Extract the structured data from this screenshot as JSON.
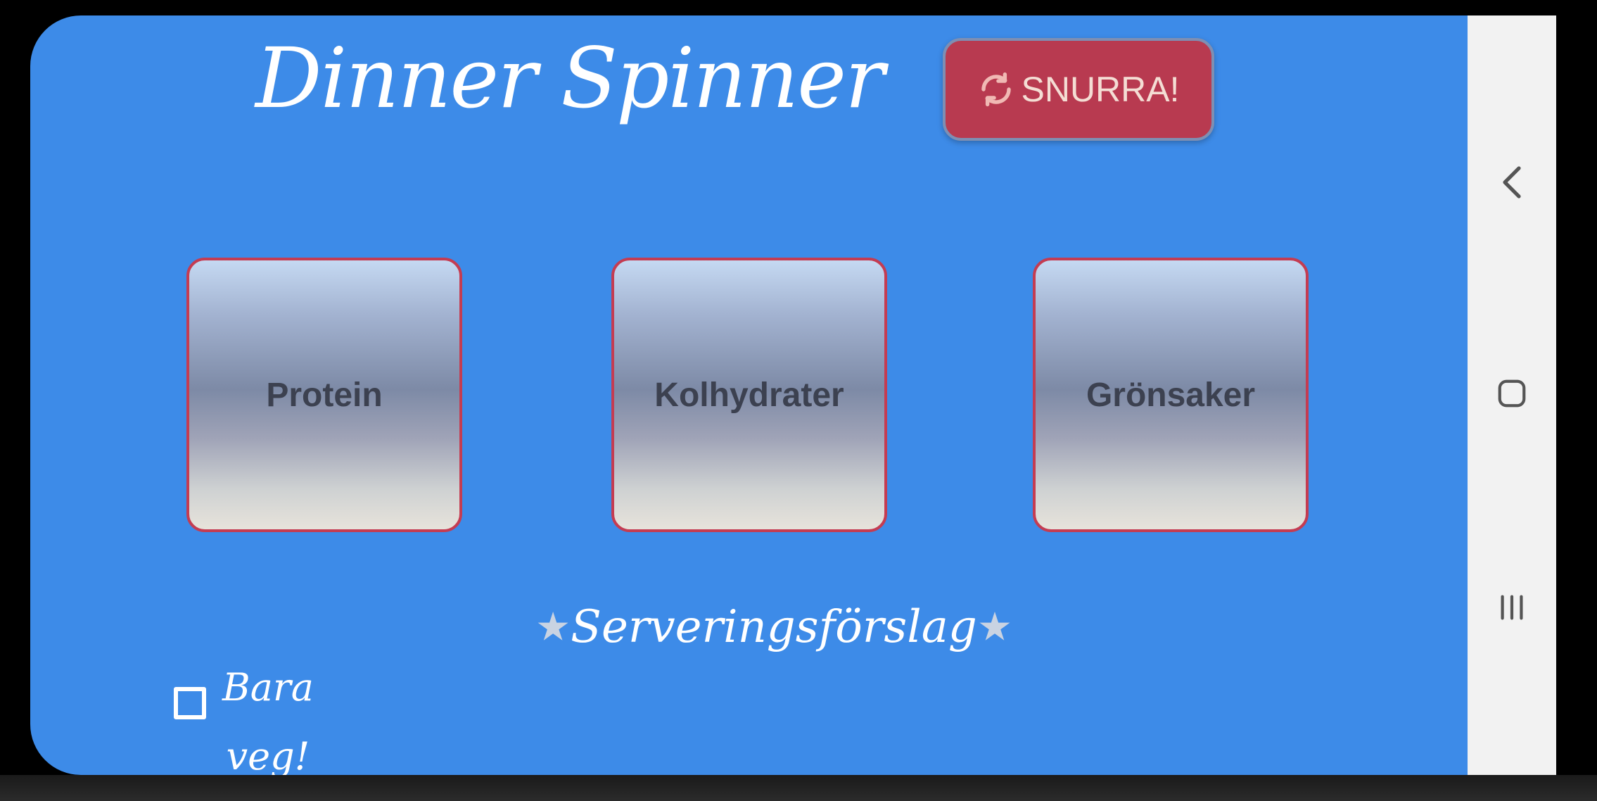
{
  "app": {
    "title": "Dinner Spinner"
  },
  "spin_button": {
    "label": "SNURRA!",
    "icon": "refresh-icon"
  },
  "categories": [
    {
      "label": "Protein"
    },
    {
      "label": "Kolhydrater"
    },
    {
      "label": "Grönsaker"
    }
  ],
  "suggestion": {
    "label": "Serveringsförslag",
    "star": "★"
  },
  "veg_option": {
    "label": "Bara\nveg!",
    "checked": false
  },
  "nav_bar": {
    "icons": [
      "back-icon",
      "home-icon",
      "recents-icon"
    ]
  },
  "colors": {
    "background": "#3d8be8",
    "accent": "#b83a50",
    "card_border": "#c43c52",
    "nav_bar": "#f2f2f2"
  }
}
